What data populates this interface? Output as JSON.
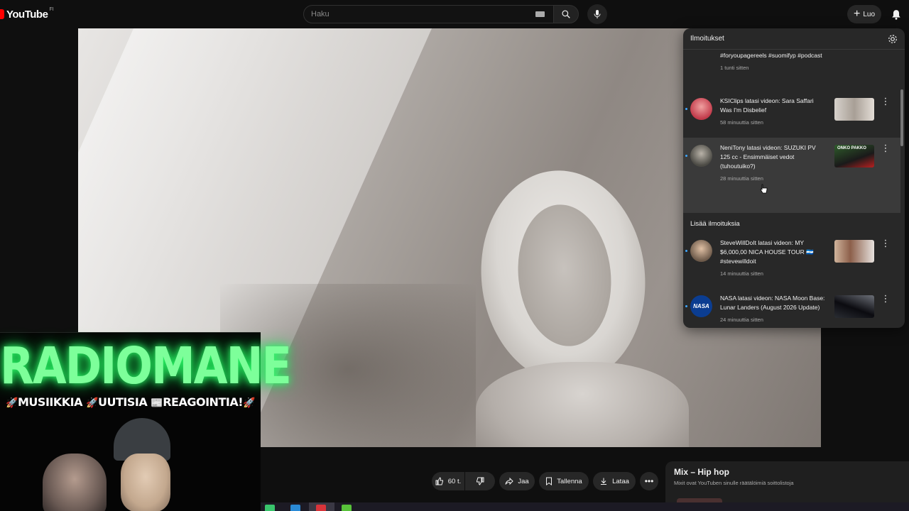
{
  "topbar": {
    "logo_text": "YouTube",
    "logo_country": "FI",
    "search_placeholder": "Haku",
    "create_label": "Luo"
  },
  "notifications": {
    "title": "Ilmoitukset",
    "items": [
      {
        "text": "#foryoupagereels #suomifyp #podcast",
        "time": "1 tunti sitten"
      },
      {
        "text": "KSIClips latasi videon: Sara Saffari Was I'm Disbelief",
        "time": "58 minuuttia sitten"
      },
      {
        "text": "NeniTony latasi videon: SUZUKI PV 125 cc - Ensimmäiset vedot (tuhoutuiko?)",
        "time": "28 minuuttia sitten"
      },
      {
        "text": "SteveWillDoIt latasi videon: MY $6,000,00 NICA HOUSE TOUR 🇳🇮 #stevewilldoit",
        "time": "14 minuuttia sitten"
      },
      {
        "text": "NASA latasi videon: NASA Moon Base: Lunar Landers (August 2026 Update)",
        "time": "24 minuuttia sitten"
      }
    ],
    "section_label": "Lisää ilmoituksia",
    "nasa_avatar_text": "NASA",
    "thumb_ksi_text": "",
    "thumb_neni_text": "ONKO PAKKO"
  },
  "overlay": {
    "title": "RADIOMANE",
    "subtitle_1": "MUSIIKKIA",
    "subtitle_2": "UUTISIA",
    "subtitle_3": "REAGOINTIA!"
  },
  "actions": {
    "like_count": "60 t.",
    "share_label": "Jaa",
    "save_label": "Tallenna",
    "download_label": "Lataa"
  },
  "mix": {
    "title": "Mix – Hip hop",
    "subtitle": "Mixit ovat YouTuben sinulle räätälöimiä soittolistoja"
  },
  "colors": {
    "brand_red": "#ff0000",
    "panel_bg": "#282828",
    "neon_green": "#7dff9a",
    "unread_dot": "#3ea6ff"
  }
}
